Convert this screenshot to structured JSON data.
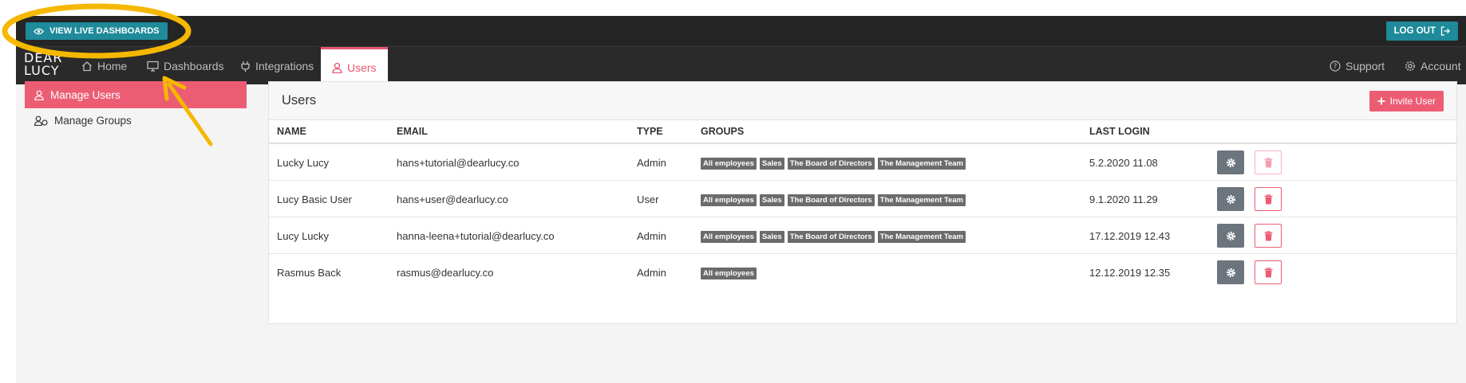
{
  "topbar": {
    "live_dashboards_label": "VIEW LIVE DASHBOARDS",
    "logout_label": "LOG OUT"
  },
  "nav": {
    "logo_line1": "DEAR",
    "logo_line2": "LUCY",
    "items": [
      {
        "label": "Home",
        "icon": "home-icon"
      },
      {
        "label": "Dashboards",
        "icon": "monitor-icon"
      },
      {
        "label": "Integrations",
        "icon": "plug-icon"
      },
      {
        "label": "Users",
        "icon": "user-icon"
      }
    ],
    "support_label": "Support",
    "account_label": "Account"
  },
  "sidebar": {
    "items": [
      {
        "label": "Manage Users",
        "icon": "user-icon"
      },
      {
        "label": "Manage Groups",
        "icon": "group-icon"
      }
    ]
  },
  "panel": {
    "title": "Users",
    "invite_label": "Invite User",
    "columns": [
      "NAME",
      "EMAIL",
      "TYPE",
      "GROUPS",
      "LAST LOGIN"
    ],
    "rows": [
      {
        "name": "Lucky Lucy",
        "email": "hans+tutorial@dearlucy.co",
        "type": "Admin",
        "groups": [
          "All employees",
          "Sales",
          "The Board of Directors",
          "The Management Team"
        ],
        "last_login": "5.2.2020 11.08"
      },
      {
        "name": "Lucy Basic User",
        "email": "hans+user@dearlucy.co",
        "type": "User",
        "groups": [
          "All employees",
          "Sales",
          "The Board of Directors",
          "The Management Team"
        ],
        "last_login": "9.1.2020 11.29"
      },
      {
        "name": "Lucy Lucky",
        "email": "hanna-leena+tutorial@dearlucy.co",
        "type": "Admin",
        "groups": [
          "All employees",
          "Sales",
          "The Board of Directors",
          "The Management Team"
        ],
        "last_login": "17.12.2019 12.43"
      },
      {
        "name": "Rasmus Back",
        "email": "rasmus@dearlucy.co",
        "type": "Admin",
        "groups": [
          "All employees"
        ],
        "last_login": "12.12.2019 12.35"
      }
    ]
  },
  "colors": {
    "accent_teal": "#1e8a9a",
    "accent_pink": "#ec5d74",
    "annotation_yellow": "#f5b800"
  }
}
